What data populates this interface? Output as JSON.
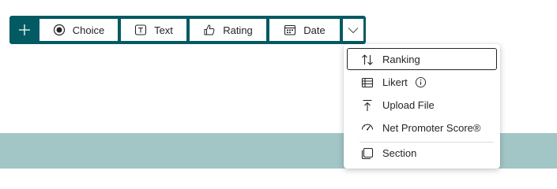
{
  "toolbar": {
    "add_icon": "plus-icon",
    "buttons": [
      {
        "label": "Choice",
        "icon": "radio-button-icon"
      },
      {
        "label": "Text",
        "icon": "text-box-icon"
      },
      {
        "label": "Rating",
        "icon": "thumbs-up-icon"
      },
      {
        "label": "Date",
        "icon": "calendar-icon"
      }
    ],
    "more_icon": "chevron-down-icon"
  },
  "menu": {
    "items": [
      {
        "label": "Ranking",
        "icon": "sort-arrows-icon",
        "focused": true
      },
      {
        "label": "Likert",
        "icon": "table-icon",
        "info_icon": "info-icon"
      },
      {
        "label": "Upload File",
        "icon": "upload-icon"
      },
      {
        "label": "Net Promoter Score®",
        "icon": "gauge-icon"
      },
      {
        "label": "Section",
        "icon": "section-icon"
      }
    ]
  },
  "colors": {
    "toolbar_bg": "#045a62",
    "band_bg": "#a2c5c6",
    "text": "#252423"
  }
}
